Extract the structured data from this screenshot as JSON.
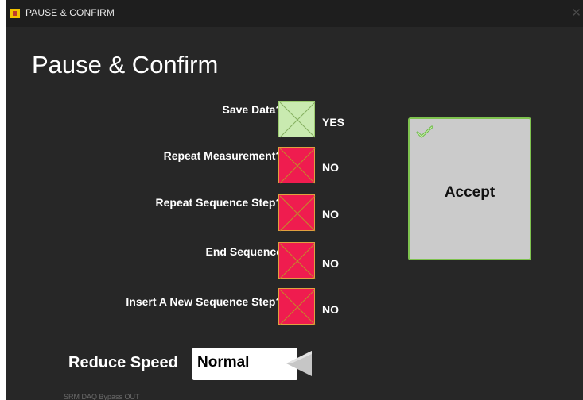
{
  "window": {
    "title": "PAUSE & CONFIRM",
    "close_icon": "close-icon",
    "app_icon": "labview-icon"
  },
  "page": {
    "title": "Pause & Confirm"
  },
  "options": [
    {
      "label": "Save Data?",
      "checked": true,
      "value": "YES"
    },
    {
      "label": "Repeat Measurement?",
      "checked": false,
      "value": "NO"
    },
    {
      "label": "Repeat Sequence Step?",
      "checked": false,
      "value": "NO"
    },
    {
      "label": "End Sequence",
      "checked": false,
      "value": "NO"
    },
    {
      "label": "Insert A New Sequence Step?",
      "checked": false,
      "value": "NO"
    }
  ],
  "accept": {
    "label": "Accept",
    "icon": "checkmark-icon"
  },
  "speed": {
    "label": "Reduce Speed",
    "value": "Normal",
    "icon": "triangle-left-icon"
  },
  "footer": {
    "text": "SRM DAQ Bypass OUT"
  },
  "colors": {
    "yes_fill": "#c9eab0",
    "no_fill": "#ef1c4f",
    "accept_border": "#7ec24f",
    "background": "#272727"
  }
}
